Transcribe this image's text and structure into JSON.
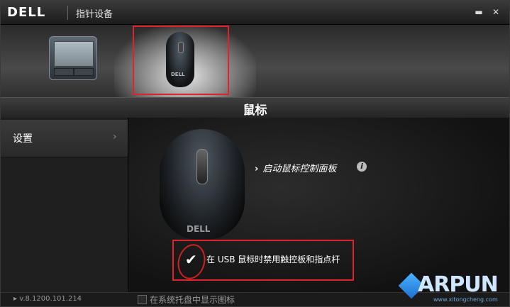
{
  "window": {
    "brand": "DELL",
    "title": "指针设备",
    "minimize": "▬",
    "close": "✕"
  },
  "devices": {
    "touchpad_name": "touchpad",
    "mouse_brand": "DELL"
  },
  "section_heading": "鼠标",
  "sidebar": {
    "items": [
      {
        "label": "设置",
        "chevron": "›"
      }
    ]
  },
  "main": {
    "mouse_brand": "DELL",
    "launch_link": "启动鼠标控制面板",
    "launch_arrow": "›",
    "info_icon": "i",
    "checkbox": {
      "checked": true,
      "mark": "✔",
      "label": "在 USB 鼠标时禁用触控板和指点杆"
    }
  },
  "footer": {
    "version": "▸ v.8.1200.101.214",
    "tray_label": "在系统托盘中显示图标",
    "tray_checked": false
  },
  "watermark": {
    "text": "ARPUN",
    "sub": "www.xitongcheng.com"
  },
  "colors": {
    "highlight": "#e0232a",
    "accent": "#1e6fd0"
  }
}
